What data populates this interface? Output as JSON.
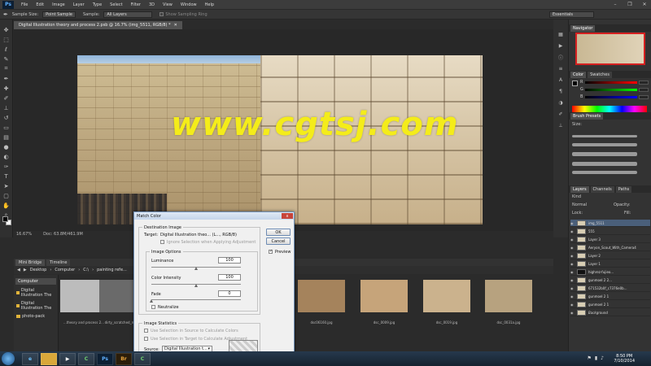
{
  "menubar": {
    "logo": "Ps",
    "items": [
      "File",
      "Edit",
      "Image",
      "Layer",
      "Type",
      "Select",
      "Filter",
      "3D",
      "View",
      "Window",
      "Help"
    ]
  },
  "options": {
    "sample_size_label": "Sample Size:",
    "sample_size_value": "Point Sample",
    "sample_label": "Sample:",
    "sample_value": "All Layers",
    "show_ring": "Show Sampling Ring",
    "workspace": "Essentials"
  },
  "document": {
    "tab_title": "Digital Illustration theory and process 2.psb @ 16.7% (img_5511, RGB/8) *",
    "zoom": "16.67%",
    "doc_size": "Doc: 63.8M/461.9M",
    "watermark": "www.cgtsj.com"
  },
  "bridge": {
    "tabs": [
      "Mini Bridge",
      "Timeline"
    ],
    "breadcrumb": [
      "Desktop",
      "Computer",
      "C:\\",
      "painting refe..."
    ],
    "side_header": "Computer",
    "side_items": [
      "Digital Illustration The",
      "Digital Illustration The",
      "photo-pack"
    ],
    "thumbs": [
      {
        "caption": "...theory and process 2...",
        "color": "#bcbcbc"
      },
      {
        "caption": "dirty_scratched_met...",
        "color": "#6a6a6a"
      },
      {
        "caption": "dsc06160.jpg",
        "color": "#a5835c"
      },
      {
        "caption": "dsc_0009.jpg",
        "color": "#c6a47a"
      },
      {
        "caption": "dsc_0019.jpg",
        "color": "#cbb28d"
      },
      {
        "caption": "dsc_0031a.jpg",
        "color": "#b7a27f"
      },
      {
        "caption": "",
        "color": "#b59e7a"
      }
    ]
  },
  "panels": {
    "navigator_tab": "Navigator",
    "color_tabs": [
      "Color",
      "Swatches"
    ],
    "brush_tab": "Brush Presets",
    "brush_size": "Size:",
    "layer_tabs": [
      "Layers",
      "Channels",
      "Paths"
    ],
    "blend_mode": "Normal",
    "opacity_label": "Opacity:",
    "lock_label": "Lock:",
    "fill_label": "Fill:",
    "kind_label": "Kind",
    "layers": [
      "img_5511",
      "555",
      "Layer 3",
      "Aeryon_Scout_With_Camera4",
      "Layer 2",
      "Layer 1",
      "highrez-fujieo...",
      "gunmoel 2 2...",
      "671532b0f_c7376e0b...",
      "gunmoel 2 1",
      "gunmoel 2 1",
      "Background"
    ]
  },
  "dialog": {
    "title": "Match Color",
    "dest_group": "Destination Image",
    "target_label": "Target:",
    "target_value": "Digital Illustration theo... (L..., RGB/8)",
    "ignore_sel": "Ignore Selection when Applying Adjustment",
    "options_group": "Image Options",
    "luminance_label": "Luminance",
    "luminance_value": "100",
    "intensity_label": "Color Intensity",
    "intensity_value": "100",
    "fade_label": "Fade",
    "fade_value": "0",
    "neutralize": "Neutralize",
    "stats_group": "Image Statistics",
    "use_sel_source": "Use Selection in Source to Calculate Colors",
    "use_sel_target": "Use Selection in Target to Calculate Adjustment",
    "source_label": "Source:",
    "source_value": "Digital Illustration t...",
    "ok": "OK",
    "cancel": "Cancel",
    "preview": "Preview",
    "close": "x"
  },
  "taskbar": {
    "time": "8:50 PM",
    "date": "7/10/2014",
    "apps": [
      "e",
      "",
      "",
      "C",
      "Ps",
      "Br",
      "C"
    ]
  },
  "colors": {
    "watermark": "#f4ec1a",
    "accent_red": "#d52020"
  }
}
